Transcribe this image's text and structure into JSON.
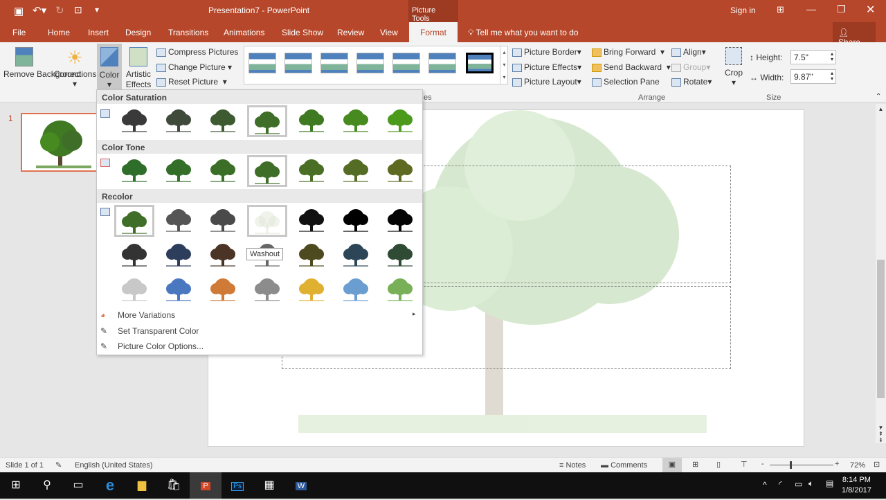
{
  "title": {
    "doc": "Presentation7  -  PowerPoint",
    "context": "Picture Tools",
    "sign_in": "Sign in"
  },
  "tabs": [
    "File",
    "Home",
    "Insert",
    "Design",
    "Transitions",
    "Animations",
    "Slide Show",
    "Review",
    "View",
    "Format"
  ],
  "tell_me": "Tell me what you want to do",
  "share": "Share",
  "ribbon": {
    "remove_bg": "Remove Background",
    "corrections": "Corrections",
    "color": "Color",
    "artistic": "Artistic Effects",
    "compress": "Compress Pictures",
    "change": "Change Picture",
    "reset": "Reset Picture",
    "border": "Picture Border",
    "effects": "Picture Effects",
    "layout": "Picture Layout",
    "bring": "Bring Forward",
    "send": "Send Backward",
    "selection": "Selection Pane",
    "align": "Align",
    "group": "Group",
    "rotate": "Rotate",
    "crop": "Crop",
    "height_label": "Height:",
    "height": "7.5\"",
    "width_label": "Width:",
    "width": "9.87\"",
    "arrange": "Arrange",
    "size": "Size",
    "styles_suffix": "es"
  },
  "dropdown": {
    "sat": "Color Saturation",
    "tone": "Color Tone",
    "recolor": "Recolor",
    "tooltip": "Washout",
    "more": "More Variations",
    "transparent": "Set Transparent Color",
    "options": "Picture Color Options...",
    "sat_colors": [
      "#3a3a3a",
      "#3f4a3a",
      "#3d5a30",
      "#3f6e28",
      "#3f7a22",
      "#468a20",
      "#4c9a1c"
    ],
    "tone_colors": [
      "#2f6e2a",
      "#346f2a",
      "#3b6f28",
      "#3f6e28",
      "#4a6e26",
      "#546c24",
      "#5e6a22"
    ],
    "recolor_colors": [
      "#3f6e28",
      "#555555",
      "#4a4a4a",
      "#dfe8d8",
      "#111111",
      "#000000",
      "#050505",
      "#333333",
      "#2d3d5c",
      "#4b3426",
      "#666666",
      "#4d4a20",
      "#2c4658",
      "#2f4b34",
      "#c8c8c8",
      "#4a78c0",
      "#d07a38",
      "#8c8c8c",
      "#e0b030",
      "#6a9ed0",
      "#78b058"
    ]
  },
  "slide_number": "1",
  "status": {
    "slide": "Slide 1 of 1",
    "lang": "English (United States)",
    "notes": "Notes",
    "comments": "Comments",
    "zoom": "72%"
  },
  "clock": {
    "time": "8:14 PM",
    "date": "1/8/2017"
  }
}
